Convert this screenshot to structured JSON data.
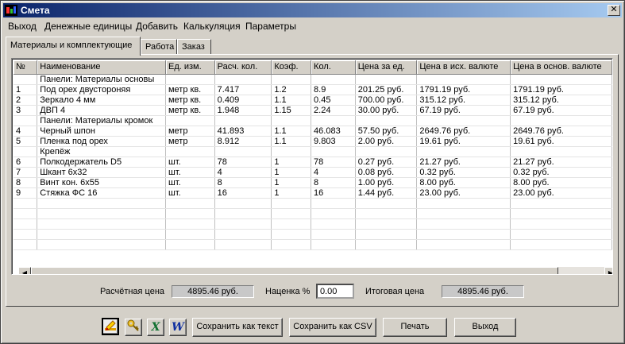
{
  "window": {
    "title": "Смета",
    "close_glyph": "✕"
  },
  "menu": [
    "Выход",
    "Денежные единицы",
    "Добавить",
    "Калькуляция",
    "Параметры"
  ],
  "tabs": [
    "Материалы и комплектующие",
    "Работа",
    "Заказ"
  ],
  "table": {
    "columns": [
      "№",
      "Наименование",
      "Ед. изм.",
      "Расч. кол.",
      "Коэф.",
      "Кол.",
      "Цена за ед.",
      "Цена в исх. валюте",
      "Цена в основ. валюте"
    ],
    "rows": [
      [
        "",
        "Панели: Материалы основы",
        "",
        "",
        "",
        "",
        "",
        "",
        ""
      ],
      [
        "1",
        "Под орех двустороняя",
        "метр кв.",
        "7.417",
        "1.2",
        "8.9",
        "201.25 руб.",
        "1791.19 руб.",
        "1791.19 руб."
      ],
      [
        "2",
        "Зеркало 4 мм",
        "метр кв.",
        "0.409",
        "1.1",
        "0.45",
        "700.00 руб.",
        "315.12 руб.",
        "315.12 руб."
      ],
      [
        "3",
        "ДВП 4",
        "метр кв.",
        "1.948",
        "1.15",
        "2.24",
        "30.00 руб.",
        "67.19 руб.",
        "67.19 руб."
      ],
      [
        "",
        "Панели: Материалы кромок",
        "",
        "",
        "",
        "",
        "",
        "",
        ""
      ],
      [
        "4",
        "Черный шпон",
        "метр",
        "41.893",
        "1.1",
        "46.083",
        "57.50 руб.",
        "2649.76 руб.",
        "2649.76 руб."
      ],
      [
        "5",
        "Пленка под орех",
        "метр",
        "8.912",
        "1.1",
        "9.803",
        "2.00 руб.",
        "19.61 руб.",
        "19.61 руб."
      ],
      [
        "",
        "Крепёж",
        "",
        "",
        "",
        "",
        "",
        "",
        ""
      ],
      [
        "6",
        "Полкодержатель D5",
        "шт.",
        "78",
        "1",
        "78",
        "0.27 руб.",
        "21.27 руб.",
        "21.27 руб."
      ],
      [
        "7",
        "Шкант 6х32",
        "шт.",
        "4",
        "1",
        "4",
        "0.08 руб.",
        "0.32 руб.",
        "0.32 руб."
      ],
      [
        "8",
        "Винт кон. 6х55",
        "шт.",
        "8",
        "1",
        "8",
        "1.00 руб.",
        "8.00 руб.",
        "8.00 руб."
      ],
      [
        "9",
        "Стяжка ФС 16",
        "шт.",
        "16",
        "1",
        "16",
        "1.44 руб.",
        "23.00 руб.",
        "23.00 руб."
      ]
    ]
  },
  "summary": {
    "calc_price_label": "Расчётная цена",
    "calc_price_value": "4895.46 руб.",
    "markup_label": "Наценка %",
    "markup_value": "0.00",
    "total_label": "Итоговая цена",
    "total_value": "4895.46 руб."
  },
  "toolbar": {
    "icons": [
      "edit-icon",
      "key-icon",
      "excel-icon",
      "word-icon"
    ],
    "excel_glyph": "X",
    "word_glyph": "W",
    "save_text": "Сохранить как текст",
    "save_csv": "Сохранить как CSV",
    "print": "Печать",
    "exit": "Выход"
  }
}
